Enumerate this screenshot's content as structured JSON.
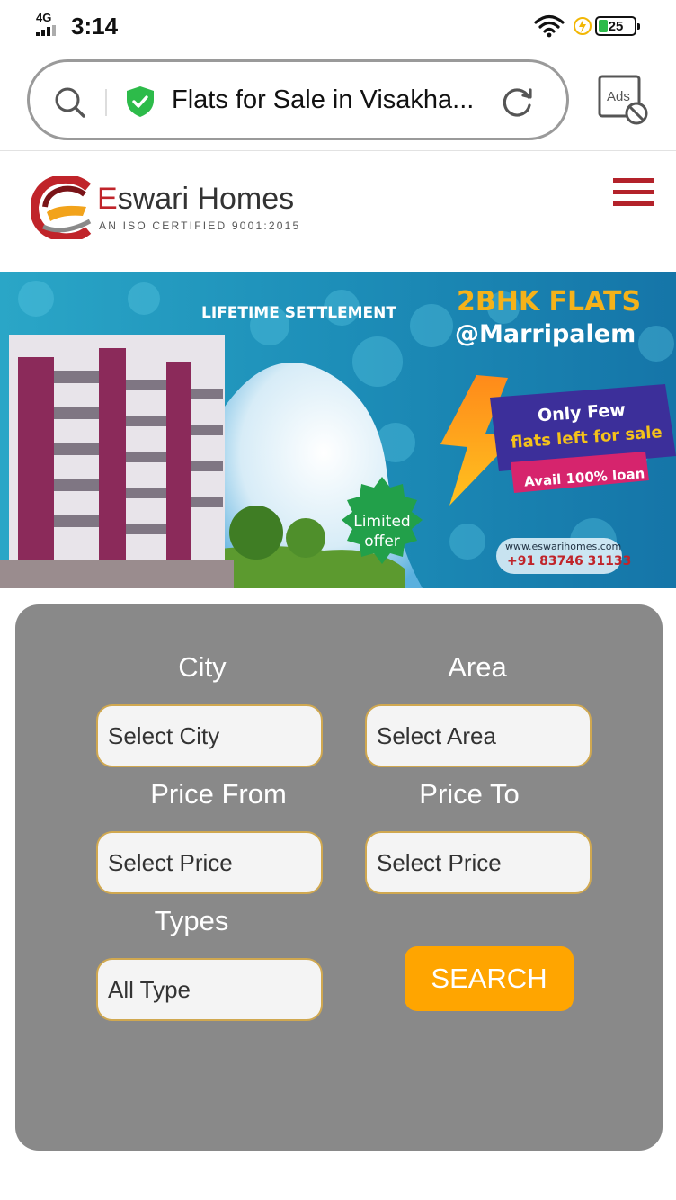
{
  "status_bar": {
    "network": "4G",
    "time": "3:14",
    "battery": "25"
  },
  "browser": {
    "url_title": "Flats for Sale in Visakha...",
    "ads_label": "Ads"
  },
  "site": {
    "logo_brand_first": "E",
    "logo_brand_rest": "swari Homes",
    "logo_tagline": "AN ISO CERTIFIED 9001:2015"
  },
  "banner": {
    "headline": "LIFETIME SETTLEMENT",
    "offer_title": "2BHK FLATS",
    "offer_location": "@Marripalem",
    "promo_line1": "Only Few",
    "promo_line2": "flats left for sale",
    "promo_loan": "Avail 100% loan",
    "badge_line1": "Limited",
    "badge_line2": "offer",
    "website": "www.eswarihomes.com",
    "phone": "+91 83746 31133"
  },
  "search_form": {
    "city_label": "City",
    "city_value": "Select City",
    "area_label": "Area",
    "area_value": "Select Area",
    "price_from_label": "Price From",
    "price_from_value": "Select Price",
    "price_to_label": "Price To",
    "price_to_value": "Select Price",
    "types_label": "Types",
    "types_value": "All Type",
    "search_button": "SEARCH"
  },
  "colors": {
    "brand_red": "#b3222a",
    "panel_gray": "#898989",
    "search_orange": "#ffa500",
    "secure_green": "#2dbb4a"
  }
}
